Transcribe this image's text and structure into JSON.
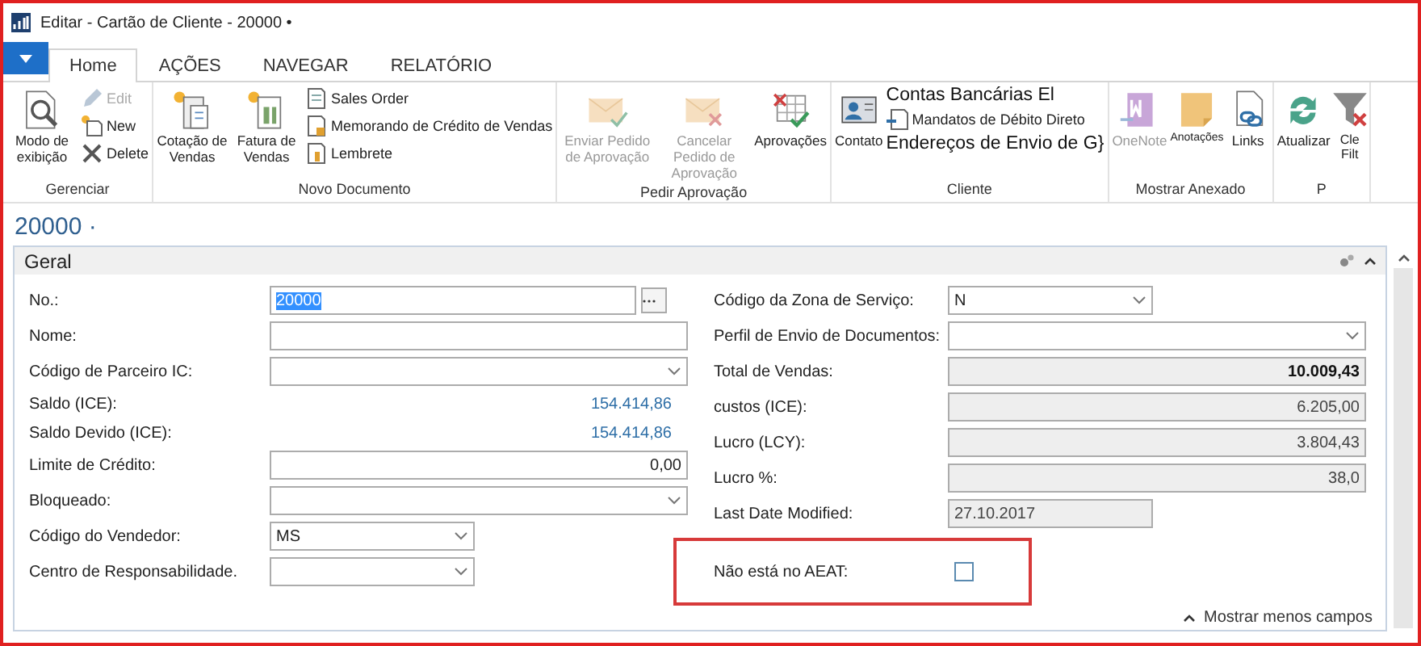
{
  "window": {
    "title": "Editar - Cartão de Cliente - 20000 •"
  },
  "tabs": [
    {
      "label": "Home",
      "selected": true
    },
    {
      "label": "AÇÕES",
      "selected": false
    },
    {
      "label": "NAVEGAR",
      "selected": false
    },
    {
      "label": "RELATÓRIO",
      "selected": false
    }
  ],
  "ribbon": {
    "groups": [
      {
        "label": "Gerenciar",
        "items": [
          {
            "kind": "large",
            "label": "Modo de exibição",
            "disabled": false
          },
          {
            "kind": "small",
            "label": "Edit",
            "disabled": true
          },
          {
            "kind": "small",
            "label": "New",
            "disabled": false
          },
          {
            "kind": "small",
            "label": "Delete",
            "disabled": false
          }
        ]
      },
      {
        "label": "Novo Documento",
        "items": [
          {
            "kind": "large",
            "label": "Cotação de Vendas",
            "disabled": false
          },
          {
            "kind": "large",
            "label": "Fatura de Vendas",
            "disabled": false
          },
          {
            "kind": "small",
            "label": "Sales Order",
            "disabled": false
          },
          {
            "kind": "small",
            "label": "Memorando de Crédito de Vendas",
            "disabled": false
          },
          {
            "kind": "small",
            "label": "Lembrete",
            "disabled": false
          }
        ]
      },
      {
        "label": "Pedir Aprovação",
        "items": [
          {
            "kind": "large",
            "label": "Enviar Pedido de Aprovação",
            "disabled": true
          },
          {
            "kind": "large",
            "label": "Cancelar Pedido de Aprovação",
            "disabled": true
          },
          {
            "kind": "large",
            "label": "Aprovações",
            "disabled": false
          }
        ]
      },
      {
        "label": "Cliente",
        "items": [
          {
            "kind": "large",
            "label": "Contato",
            "disabled": false
          },
          {
            "kind": "wide",
            "label": "Contas Bancárias El",
            "disabled": false
          },
          {
            "kind": "small",
            "label": "Mandatos de Débito Direto",
            "disabled": false
          },
          {
            "kind": "wide",
            "label": "Endereços de Envio de G}",
            "disabled": false
          }
        ]
      },
      {
        "label": "Mostrar Anexado",
        "items": [
          {
            "kind": "large",
            "label": "OneNote",
            "disabled": true
          },
          {
            "kind": "large",
            "label": "Anotações",
            "disabled": false
          },
          {
            "kind": "large",
            "label": "Links",
            "disabled": false
          }
        ]
      },
      {
        "label": "P",
        "items": [
          {
            "kind": "large",
            "label": "Atualizar",
            "disabled": false
          },
          {
            "kind": "large",
            "label": "Cle Filt",
            "disabled": false
          }
        ]
      }
    ]
  },
  "page_title": "20000 ·",
  "panel": {
    "title": "Geral",
    "left": [
      {
        "label": "No.:",
        "kind": "lookup",
        "value": "20000",
        "text_selected": true
      },
      {
        "label": "Nome:",
        "kind": "text",
        "narrow": false
      },
      {
        "label": "Código de Parceiro IC:",
        "kind": "dropdown",
        "narrow": false
      },
      {
        "label": "Saldo (ICE):",
        "kind": "amount",
        "value": "154.414,86"
      },
      {
        "label": "Saldo Devido (ICE):",
        "kind": "amount",
        "value": "154.414,86"
      },
      {
        "label": "Limite de Crédito:",
        "kind": "text",
        "value": "0,00",
        "narrow": false,
        "right_aligned": true
      },
      {
        "label": "Bloqueado:",
        "kind": "dropdown",
        "narrow": false
      },
      {
        "label": "Código do Vendedor:",
        "kind": "dropdown",
        "value": "MS",
        "narrow": true
      },
      {
        "label": "Centro de Responsabilidade.",
        "kind": "dropdown",
        "narrow": true
      }
    ],
    "right": [
      {
        "label": "Código da Zona de Serviço:",
        "kind": "dropdown",
        "value": "N",
        "narrow": true
      },
      {
        "label": "Perfil de Envio de Documentos:",
        "kind": "dropdown",
        "narrow": false
      },
      {
        "label": "Total de Vendas:",
        "kind": "readonly",
        "value": "10.009,43",
        "bold": true,
        "narrow": false,
        "right_aligned": true
      },
      {
        "label": "custos (ICE):",
        "kind": "readonly",
        "value": "6.205,00",
        "bold": false,
        "narrow": false,
        "right_aligned": true
      },
      {
        "label": "Lucro (LCY):",
        "kind": "readonly",
        "value": "3.804,43",
        "bold": false,
        "narrow": false,
        "right_aligned": true
      },
      {
        "label": "Lucro %:",
        "kind": "readonly",
        "value": "38,0",
        "bold": false,
        "narrow": false,
        "right_aligned": true
      },
      {
        "label": "Last Date Modified:",
        "kind": "readonly",
        "value": "27.10.2017",
        "bold": false,
        "narrow": true,
        "right_aligned": false
      },
      {
        "label": "Não está no AEAT:",
        "kind": "checkbox",
        "checked": false,
        "highlighted": true
      }
    ]
  },
  "footer_link": "Mostrar menos campos"
}
